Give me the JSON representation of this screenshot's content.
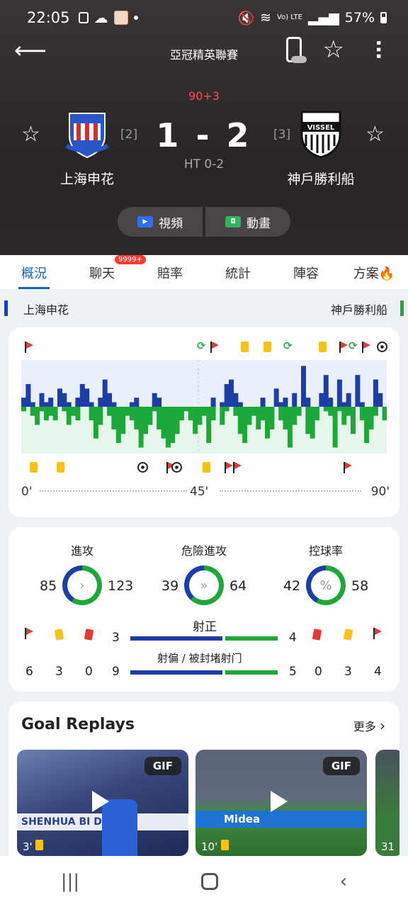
{
  "status_bar": {
    "time": "22:05",
    "battery": "57%",
    "network": "Vo) LTE"
  },
  "header": {
    "competition": "亞冠精英聯賽",
    "minute": "90+3",
    "score": "1 - 2",
    "halftime": "HT 0-2"
  },
  "home": {
    "name": "上海申花",
    "rank": "[2]",
    "crest_text": "SHENHUA",
    "color": "#1d3ea8"
  },
  "away": {
    "name": "神戶勝利船",
    "rank": "[3]",
    "crest_text": "VISSEL",
    "color": "#1ea83a"
  },
  "media_buttons": {
    "video": "視頻",
    "animation": "動畫"
  },
  "tabs": [
    {
      "label": "概況",
      "active": true
    },
    {
      "label": "聊天",
      "badge": "9999+"
    },
    {
      "label": "賠率"
    },
    {
      "label": "統計"
    },
    {
      "label": "陣容"
    },
    {
      "label": "方案"
    }
  ],
  "momentum": {
    "axis": [
      "0'",
      "45'",
      "90'"
    ],
    "home_values": [
      0.2,
      0.5,
      0.1,
      0.0,
      0.3,
      0.1,
      0.2,
      0.0,
      0.4,
      0.3,
      0.1,
      0.0,
      0.2,
      0.5,
      0.4,
      0.1,
      0.0,
      0.2,
      0.6,
      0.3,
      0.1,
      0.0,
      0.0,
      0.0,
      0.1,
      0.2,
      0.0,
      0.0,
      0.0,
      0.3,
      0.2,
      0.0,
      0.0,
      0.0,
      0.0,
      0.0,
      0.0,
      0.0,
      0.0,
      0.0,
      0.0,
      0.0,
      0.2,
      0.0,
      0.1,
      0.5,
      0.6,
      0.3,
      0.1,
      0.0,
      0.0,
      0.0,
      0.0,
      0.2,
      0.0,
      0.0,
      0.4,
      0.1,
      0.2,
      0.0,
      0.3,
      0.0,
      0.9,
      0.2,
      0.0,
      0.0,
      0.3,
      0.7,
      0.2,
      0.0,
      0.6,
      0.1,
      0.3,
      0.0,
      0.7,
      0.1,
      0.0,
      0.0,
      0.6,
      0.3,
      0.0
    ],
    "away_values": [
      0.1,
      0.0,
      0.2,
      0.4,
      0.1,
      0.3,
      0.2,
      0.3,
      0.0,
      0.1,
      0.4,
      0.2,
      0.3,
      0.0,
      0.0,
      0.3,
      0.7,
      0.4,
      0.0,
      0.2,
      0.5,
      0.8,
      0.6,
      0.2,
      0.3,
      0.5,
      0.9,
      0.6,
      0.4,
      0.1,
      0.5,
      0.7,
      0.9,
      0.8,
      0.6,
      0.3,
      0.1,
      0.3,
      0.6,
      0.4,
      0.2,
      0.8,
      0.3,
      0.0,
      0.4,
      0.1,
      0.0,
      0.2,
      0.6,
      0.8,
      0.4,
      0.2,
      0.5,
      0.3,
      0.7,
      0.5,
      0.0,
      0.3,
      0.5,
      0.9,
      0.4,
      0.2,
      0.0,
      0.6,
      0.7,
      0.3,
      0.0,
      0.1,
      0.2,
      0.9,
      0.1,
      0.4,
      0.2,
      0.6,
      0.0,
      0.3,
      0.8,
      0.5,
      0.2,
      0.0,
      0.3
    ]
  },
  "stats": {
    "attack": {
      "label": "進攻",
      "home": "85",
      "away": "123"
    },
    "dangerous": {
      "label": "危險進攻",
      "home": "39",
      "away": "64"
    },
    "possession": {
      "label": "控球率",
      "home": "42",
      "away": "58"
    },
    "shots_on": {
      "label": "射正",
      "home": "3",
      "away": "4"
    },
    "shots_off": {
      "label": "射偏 / 被封堵射门",
      "home": "9",
      "away": "5"
    },
    "home_counts": {
      "corners": "6",
      "yellow": "3",
      "red": "0"
    },
    "away_counts": {
      "red": "0",
      "yellow": "3",
      "corners": "4"
    }
  },
  "replays": {
    "title": "Goal Replays",
    "more": "更多",
    "items": [
      {
        "badge": "GIF",
        "minute": "3'",
        "caption": "SHENHUA BI DEVE"
      },
      {
        "badge": "GIF",
        "minute": "10'",
        "caption": "Midea"
      },
      {
        "minute": "31"
      }
    ]
  }
}
